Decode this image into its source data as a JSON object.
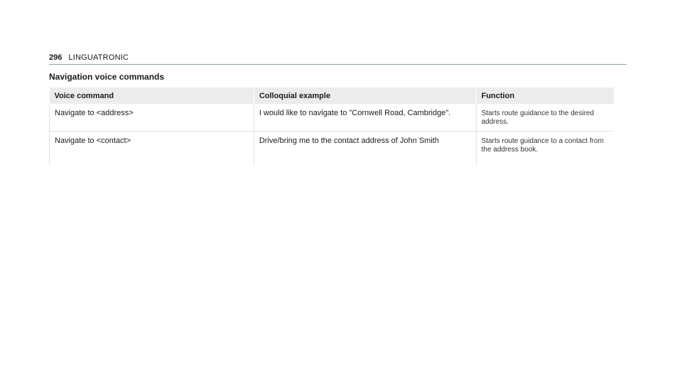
{
  "header": {
    "page_number": "296",
    "chapter_title": "LINGUATRONIC"
  },
  "section": {
    "title": "Navigation voice commands"
  },
  "table": {
    "columns": [
      "Voice command",
      "Colloquial example",
      "Function"
    ],
    "rows": [
      {
        "command": "Navigate to <address>",
        "example": "I would like to navigate to \"Cornwell Road, Cambridge\".",
        "function": "Starts route guidance to the desired address."
      },
      {
        "command": "Navigate to <contact>",
        "example": "Drive/bring me to the contact address of John Smith",
        "function": "Starts route guidance to a contact from the address book."
      }
    ]
  }
}
